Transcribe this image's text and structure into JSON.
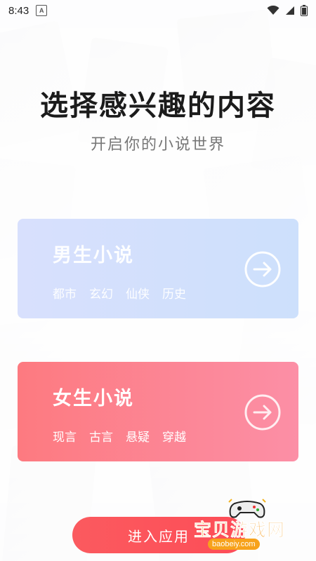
{
  "status_bar": {
    "time": "8:43",
    "notification_letter": "A"
  },
  "header": {
    "title": "选择感兴趣的内容",
    "subtitle": "开启你的小说世界"
  },
  "cards": [
    {
      "title": "男生小说",
      "tags": [
        "都市",
        "玄幻",
        "仙侠",
        "历史"
      ]
    },
    {
      "title": "女生小说",
      "tags": [
        "现言",
        "古言",
        "悬疑",
        "穿越"
      ]
    }
  ],
  "enter_button": {
    "label": "进入应用"
  },
  "watermark": {
    "text": "宝贝游戏网",
    "url": "baobeiy.com"
  },
  "colors": {
    "male_card": "#d3e0fd",
    "female_card": "#fd8090",
    "enter_button": "#fb5a5f",
    "title_text": "#1b1b1b"
  },
  "icons": [
    "wifi-icon",
    "signal-icon",
    "battery-icon",
    "arrow-right-circle-icon",
    "gamepad-icon"
  ]
}
